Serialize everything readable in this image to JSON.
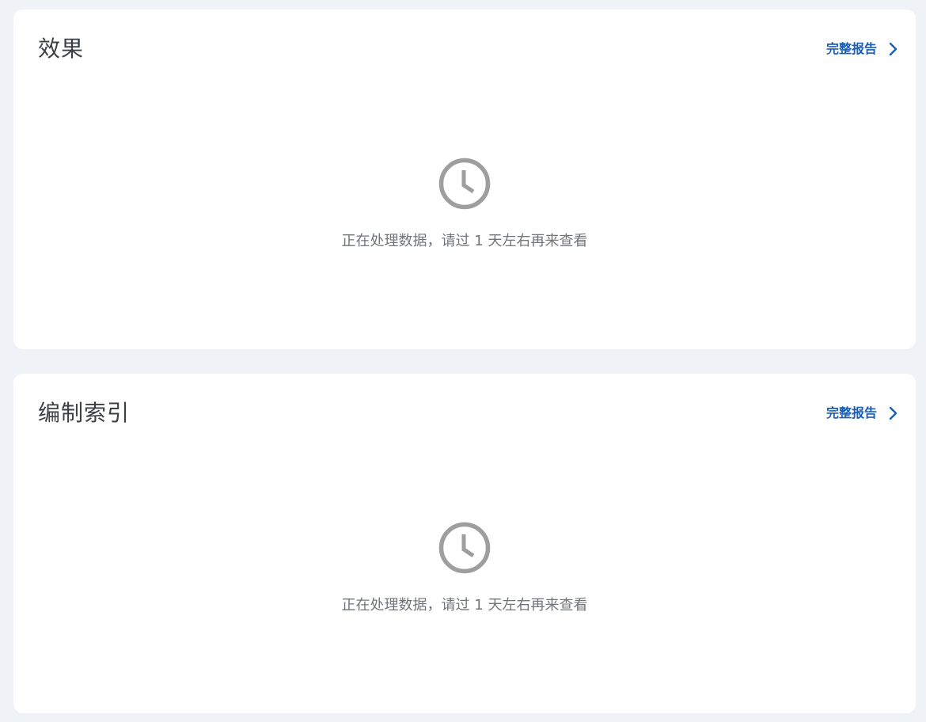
{
  "cards": [
    {
      "title": "效果",
      "report_link": "完整报告",
      "message": "正在处理数据，请过 1 天左右再来查看",
      "icon": "clock-icon"
    },
    {
      "title": "编制索引",
      "report_link": "完整报告",
      "message": "正在处理数据，请过 1 天左右再来查看",
      "icon": "clock-icon"
    }
  ],
  "colors": {
    "background": "#eff3f8",
    "card": "#ffffff",
    "link": "#1a5fb4",
    "icon": "#9e9e9e",
    "muted_text": "#70757a"
  }
}
